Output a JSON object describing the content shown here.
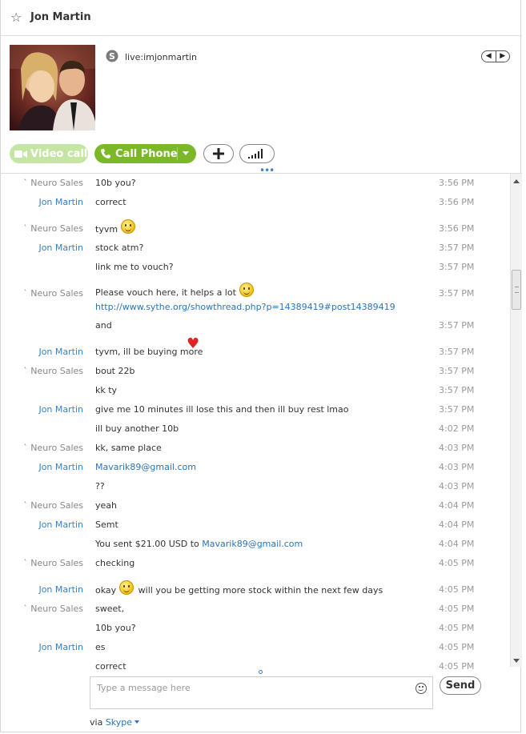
{
  "header": {
    "contact_name": "Jon Martin"
  },
  "profile": {
    "skype_id": "live:imjonmartin"
  },
  "actions": {
    "video_call_label": "Video call",
    "call_phone_label": "Call Phone"
  },
  "messages": [
    {
      "sender": "` Neuro Sales",
      "side": "neuro",
      "text": "10b you?",
      "time": "3:56 PM"
    },
    {
      "sender": "Jon Martin",
      "side": "jon",
      "text": "correct",
      "time": "3:56 PM"
    },
    {
      "sender": "` Neuro Sales",
      "side": "neuro",
      "text": "tyvm",
      "time": "3:56 PM",
      "emoji": "smile"
    },
    {
      "sender": "Jon Martin",
      "side": "jon",
      "text": "stock atm?",
      "time": "3:57 PM"
    },
    {
      "sender": "",
      "side": "jon",
      "text": "link me to vouch?",
      "time": "3:57 PM"
    },
    {
      "sender": "` Neuro Sales",
      "side": "neuro",
      "text": "Please vouch here, it helps a lot",
      "link": "http://www.sythe.org/showthread.php?p=14389419#post14389419",
      "time": "3:57 PM",
      "emoji": "smile"
    },
    {
      "sender": "",
      "side": "neuro",
      "text": "and",
      "time": "3:57 PM"
    },
    {
      "sender": "Jon Martin",
      "side": "jon",
      "text": "tyvm, ill be buying more",
      "time": "3:57 PM",
      "emoji": "heart"
    },
    {
      "sender": "` Neuro Sales",
      "side": "neuro",
      "text": "bout 22b",
      "time": "3:57 PM"
    },
    {
      "sender": "",
      "side": "neuro",
      "text": "kk ty",
      "time": "3:57 PM"
    },
    {
      "sender": "Jon Martin",
      "side": "jon",
      "text": "give me 10 minutes ill lose this and then ill buy rest lmao",
      "time": "3:57 PM"
    },
    {
      "sender": "",
      "side": "jon",
      "text": "ill buy another 10b",
      "time": "4:02 PM"
    },
    {
      "sender": "` Neuro Sales",
      "side": "neuro",
      "text": "kk, same place",
      "time": "4:03 PM"
    },
    {
      "sender": "Jon Martin",
      "side": "jon",
      "text": "",
      "link": "Mavarik89@gmail.com",
      "time": "4:03 PM"
    },
    {
      "sender": "",
      "side": "jon",
      "text": "??",
      "time": "4:03 PM"
    },
    {
      "sender": "` Neuro Sales",
      "side": "neuro",
      "text": "yeah",
      "time": "4:04 PM"
    },
    {
      "sender": "Jon Martin",
      "side": "jon",
      "text": "Semt",
      "time": "4:04 PM"
    },
    {
      "sender": "",
      "side": "jon",
      "text": "You sent $21.00 USD to",
      "link": "Mavarik89@gmail.com",
      "time": "4:04 PM"
    },
    {
      "sender": "` Neuro Sales",
      "side": "neuro",
      "text": "checking",
      "time": "4:05 PM"
    },
    {
      "sender": "Jon Martin",
      "side": "jon",
      "text": "okay",
      "text_after": "will you be getting more stock within the next few days",
      "time": "4:05 PM",
      "emoji": "smile"
    },
    {
      "sender": "` Neuro Sales",
      "side": "neuro",
      "text": "sweet,",
      "time": "4:05 PM"
    },
    {
      "sender": "",
      "side": "neuro",
      "text": "10b you?",
      "time": "4:05 PM"
    },
    {
      "sender": "Jon Martin",
      "side": "jon",
      "text": "es",
      "time": "4:05 PM"
    },
    {
      "sender": "",
      "side": "jon",
      "text": "correct",
      "time": "4:05 PM"
    }
  ],
  "composer": {
    "placeholder": "Type a message here",
    "send_label": "Send",
    "via_prefix": "via",
    "via_service": "Skype"
  }
}
